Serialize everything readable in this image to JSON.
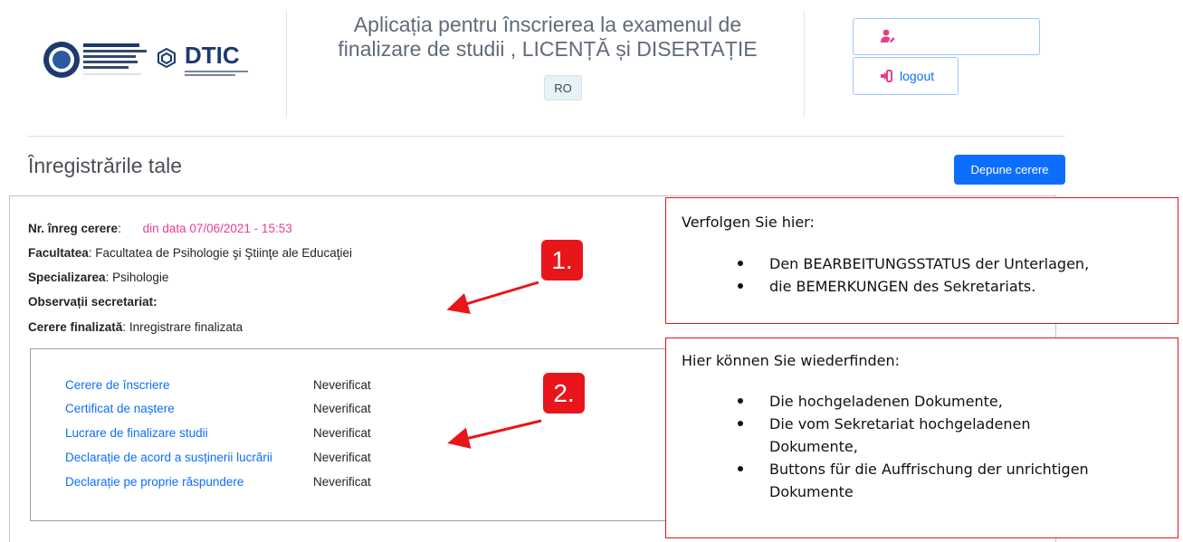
{
  "header": {
    "app_title_line1": "Aplicația pentru înscrierea la examenul de",
    "app_title_line2": "finalizare de studii , LICENȚĂ și DISERTAȚIE",
    "language": "RO",
    "logout_label": "logout",
    "logo_text": "DTIC"
  },
  "page": {
    "title": "Înregistrările tale",
    "submit_button": "Depune cerere"
  },
  "registration": {
    "nr_label": "Nr. înreg cerere",
    "date_text": "din data 07/06/2021 - 15:53",
    "faculty_label": "Facultatea",
    "faculty_value": "Facultatea de Psihologie şi Ştiinţe ale Educaţiei",
    "specialization_label": "Specializarea",
    "specialization_value": "Psihologie",
    "observations_label": "Observații secretariat",
    "finalized_label": "Cerere finalizată",
    "finalized_value": "Inregistrare finalizata"
  },
  "documents": [
    {
      "name": "Cerere de înscriere",
      "status": "Neverificat"
    },
    {
      "name": "Certificat de naștere",
      "status": "Neverificat"
    },
    {
      "name": "Lucrare de finalizare studii",
      "status": "Neverificat"
    },
    {
      "name": "Declarație de acord a susținerii lucrării",
      "status": "Neverificat"
    },
    {
      "name": "Declarație pe proprie răspundere",
      "status": "Neverificat"
    }
  ],
  "annotations": {
    "badge1": "1.",
    "badge2": "2.",
    "note1": {
      "heading": "Verfolgen Sie hier:",
      "items": [
        "Den BEARBEITUNGSSTATUS der Unterlagen,",
        "die BEMERKUNGEN des Sekretariats."
      ]
    },
    "note2": {
      "heading": "Hier können Sie wiederfinden:",
      "items": [
        "Die hochgeladenen Dokumente,",
        "Die vom Sekretariat hochgeladenen Dokumente,",
        "Buttons für die Auffrischung der unrichtigen Dokumente"
      ]
    }
  },
  "colors": {
    "primary": "#0d6efd",
    "accent_pink": "#e83e8c",
    "annotation_red": "#e8161b"
  }
}
